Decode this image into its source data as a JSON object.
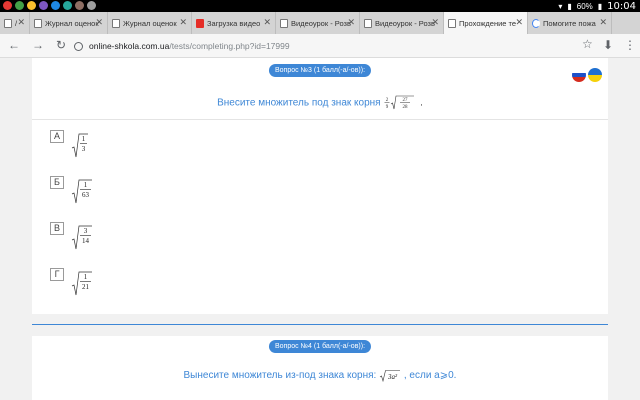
{
  "status": {
    "battery": "60%",
    "time": "10:04"
  },
  "tabs": [
    {
      "label": "/",
      "icon": "doc-icon"
    },
    {
      "label": "Журнал оценок",
      "icon": "doc-icon"
    },
    {
      "label": "Журнал оценок",
      "icon": "doc-icon"
    },
    {
      "label": "Загрузка видео",
      "icon": "youtube-icon"
    },
    {
      "label": "Видеоурок - Розв",
      "icon": "doc-icon"
    },
    {
      "label": "Видеоурок - Розв",
      "icon": "doc-icon"
    },
    {
      "label": "Прохождение те",
      "icon": "doc-icon"
    },
    {
      "label": "Помогите пожа",
      "icon": "loading-icon"
    }
  ],
  "toolbar": {
    "url_host": "online-shkola.com.ua",
    "url_path": "/tests/completing.php?id=17999"
  },
  "question3": {
    "title": "Вопрос №3 (1 балл(-а/-ов)):",
    "text": "Внесите множитель под знак корня",
    "expr": {
      "coef_num": "2",
      "coef_den": "9",
      "rad_num": "27",
      "rad_den": "28"
    },
    "answers": [
      {
        "letter": "А",
        "num": "1",
        "den": "3"
      },
      {
        "letter": "Б",
        "num": "1",
        "den": "63"
      },
      {
        "letter": "В",
        "num": "3",
        "den": "14"
      },
      {
        "letter": "Г",
        "num": "1",
        "den": "21"
      }
    ]
  },
  "question4": {
    "title": "Вопрос №4 (1 балл(-а/-ов)):",
    "text": "Вынесите множитель из-под знака корня:",
    "radicand": "3a²",
    "condition": ", если a⩾0."
  },
  "colors": {
    "accent": "#3e87d6"
  }
}
